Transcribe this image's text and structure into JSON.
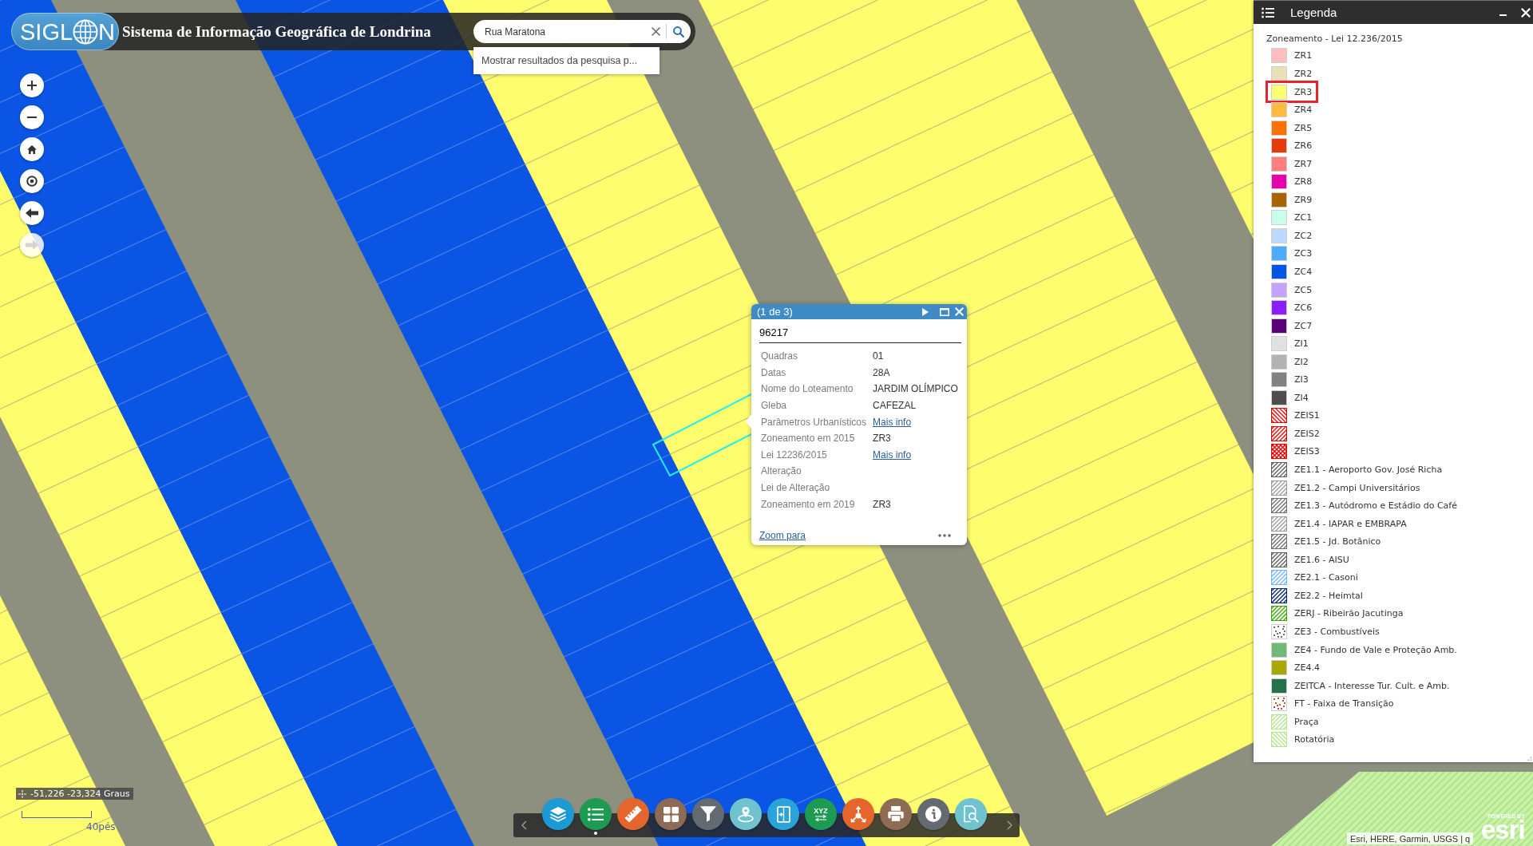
{
  "header": {
    "logo": {
      "prefix": "SIGL",
      "suffix": "N"
    },
    "title": "Sistema de Informação Geográfica de Londrina",
    "search": {
      "value": "Rua Maratona",
      "suggestion": "Mostrar resultados da pesquisa p..."
    }
  },
  "map_controls": [
    {
      "disabled": false
    },
    {
      "disabled": false
    },
    {
      "disabled": false
    },
    {
      "disabled": false
    },
    {
      "disabled": false
    },
    {
      "disabled": true
    }
  ],
  "popup": {
    "pager": "(1 de 3)",
    "title": "96217",
    "fields": [
      {
        "label": "Quadras",
        "value": "01",
        "kind": "text"
      },
      {
        "label": "Datas",
        "value": "28A",
        "kind": "text"
      },
      {
        "label": "Nome do Loteamento",
        "value": "JARDIM OLÍMPICO",
        "kind": "text"
      },
      {
        "label": "Gleba",
        "value": "CAFEZAL",
        "kind": "text"
      },
      {
        "label": "Parâmetros Urbanísticos",
        "value": "Mais info",
        "kind": "link"
      },
      {
        "label": "Zoneamento em 2015",
        "value": "ZR3",
        "kind": "text"
      },
      {
        "label": "Lei 12236/2015",
        "value": "Mais info",
        "kind": "link"
      },
      {
        "label": "Alteração"
      },
      {
        "label": "Lei de Alteração"
      },
      {
        "label": "Zoneamento em 2019",
        "value": "ZR3",
        "kind": "text"
      }
    ],
    "footer_link": "Zoom para"
  },
  "legend": {
    "title": "Legenda",
    "group": "Zoneamento - Lei 12.236/2015",
    "items": [
      {
        "label": "ZR1",
        "kind": "solid",
        "color": "#ffbebe",
        "highlighted": false
      },
      {
        "label": "ZR2",
        "kind": "solid",
        "color": "#ebdfb8",
        "highlighted": false
      },
      {
        "label": "ZR3",
        "kind": "solid",
        "color": "#ffff73",
        "highlighted": true
      },
      {
        "label": "ZR4",
        "kind": "solid",
        "color": "#ffba3f",
        "highlighted": false
      },
      {
        "label": "ZR5",
        "kind": "solid",
        "color": "#ff7200",
        "highlighted": false
      },
      {
        "label": "ZR6",
        "kind": "solid",
        "color": "#e63a0c",
        "highlighted": false
      },
      {
        "label": "ZR7",
        "kind": "solid",
        "color": "#ff7f7f",
        "highlighted": false
      },
      {
        "label": "ZR8",
        "kind": "solid",
        "color": "#e600a9",
        "highlighted": false
      },
      {
        "label": "ZR9",
        "kind": "solid",
        "color": "#a86400",
        "highlighted": false
      },
      {
        "label": "ZC1",
        "kind": "solid",
        "color": "#c8ffea",
        "highlighted": false
      },
      {
        "label": "ZC2",
        "kind": "solid",
        "color": "#bed9ff",
        "highlighted": false
      },
      {
        "label": "ZC3",
        "kind": "solid",
        "color": "#4eacff",
        "highlighted": false
      },
      {
        "label": "ZC4",
        "kind": "solid",
        "color": "#0055e6",
        "highlighted": false
      },
      {
        "label": "ZC5",
        "kind": "solid",
        "color": "#c4a3ff",
        "highlighted": false
      },
      {
        "label": "ZC6",
        "kind": "solid",
        "color": "#8a1eff",
        "highlighted": false
      },
      {
        "label": "ZC7",
        "kind": "solid",
        "color": "#5c0077",
        "highlighted": false
      },
      {
        "label": "ZI1",
        "kind": "solid",
        "color": "#e1e1e1",
        "highlighted": false
      },
      {
        "label": "ZI2",
        "kind": "solid",
        "color": "#b2b2b2",
        "highlighted": false
      },
      {
        "label": "ZI3",
        "kind": "solid",
        "color": "#828282",
        "highlighted": false
      },
      {
        "label": "ZI4",
        "kind": "solid",
        "color": "#4e4e4e",
        "highlighted": false
      },
      {
        "label": "ZEIS1",
        "kind": "backslash",
        "color": "#e60000",
        "highlighted": false
      },
      {
        "label": "ZEIS2",
        "kind": "slash",
        "color": "#e60000",
        "highlighted": false
      },
      {
        "label": "ZEIS3",
        "kind": "cross",
        "color": "#e60000",
        "highlighted": false
      },
      {
        "label": "ZE1.1 - Aeroporto Gov. José Richa",
        "kind": "slash",
        "color": "#5e5e5e",
        "highlighted": false
      },
      {
        "label": "ZE1.2 - Campi Universitários",
        "kind": "slash",
        "color": "#9c9c9c",
        "highlighted": false
      },
      {
        "label": "ZE1.3 - Autódromo e Estádio do Café",
        "kind": "slash",
        "color": "#6e6e6e",
        "highlighted": false
      },
      {
        "label": "ZE1.4 - IAPAR e EMBRAPA",
        "kind": "slash",
        "color": "#9c9c9c",
        "highlighted": false
      },
      {
        "label": "ZE1.5 - Jd. Botânico",
        "kind": "slash",
        "color": "#6e6e6e",
        "highlighted": false
      },
      {
        "label": "ZE1.6 - AISU",
        "kind": "slash",
        "color": "#5e5e5e",
        "highlighted": false
      },
      {
        "label": "ZE2.1 - Casoni",
        "kind": "slash",
        "color": "#73b2ff",
        "highlighted": false
      },
      {
        "label": "ZE2.2 - Heimtal",
        "kind": "slash",
        "color": "#00206e",
        "highlighted": false
      },
      {
        "label": "ZERJ - Ribeirão Jacutinga",
        "kind": "slash",
        "color": "#38a800",
        "highlighted": false
      },
      {
        "label": "ZE3 - Combustíveis",
        "kind": "dots",
        "color": "#6e6e6e",
        "highlighted": false
      },
      {
        "label": "ZE4 - Fundo de Vale e Proteção Amb.",
        "kind": "solid",
        "color": "#72b877",
        "highlighted": false
      },
      {
        "label": "ZE4.4",
        "kind": "solid",
        "color": "#a8a800",
        "highlighted": false
      },
      {
        "label": "ZEITCA - Interesse Tur. Cult. e Amb.",
        "kind": "solid",
        "color": "#26704a",
        "highlighted": false
      },
      {
        "label": "FT - Faixa de Transição",
        "kind": "dots",
        "color": "#a85a3a",
        "highlighted": false
      },
      {
        "label": "Praça",
        "kind": "slash",
        "color": "#b4e68c",
        "highlighted": false
      },
      {
        "label": "Rotatória",
        "kind": "backslash",
        "color": "#b4e68c",
        "highlighted": false
      }
    ]
  },
  "toolbar": {
    "tools": [
      {
        "color": "#1b9ad6",
        "selected": false
      },
      {
        "color": "#1d9b53",
        "selected": true
      },
      {
        "color": "#e5662c",
        "selected": false
      },
      {
        "color": "#8e6b55",
        "selected": false
      },
      {
        "color": "#646a72",
        "selected": false
      },
      {
        "color": "#6fc3cf",
        "selected": false
      },
      {
        "color": "#2aa3da",
        "selected": false
      },
      {
        "color": "#1d9b53",
        "selected": false,
        "label": "XYZ"
      },
      {
        "color": "#e5662c",
        "selected": false
      },
      {
        "color": "#8e6b55",
        "selected": false
      },
      {
        "color": "#646a72",
        "selected": false
      },
      {
        "color": "#6fc3cf",
        "selected": false
      }
    ]
  },
  "coordinates": "-51,226 -23,324 Graus",
  "scale": "40pés",
  "attribution": "Esri, HERE, Garmin, USGS | q",
  "powered_logo": {
    "caption": "POWERED BY",
    "wordmark": "esri"
  }
}
